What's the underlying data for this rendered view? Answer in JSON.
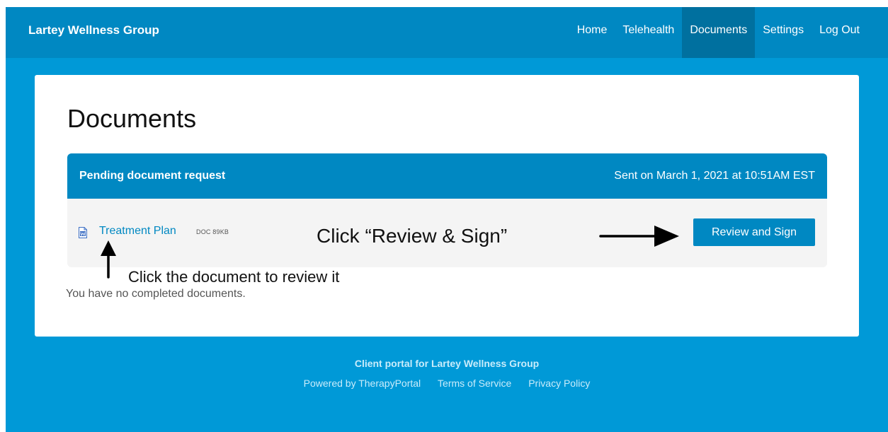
{
  "navbar": {
    "brand": "Lartey Wellness Group",
    "links": [
      {
        "label": "Home"
      },
      {
        "label": "Telehealth"
      },
      {
        "label": "Documents",
        "active": true
      },
      {
        "label": "Settings"
      },
      {
        "label": "Log Out"
      }
    ]
  },
  "main": {
    "title": "Documents",
    "pending_request": {
      "title": "Pending document request",
      "sent": "Sent on March 1, 2021 at 10:51AM EST",
      "document": {
        "icon": "word-document-icon",
        "name": "Treatment Plan",
        "meta": "DOC 89KB"
      },
      "action_label": "Review and Sign"
    },
    "completed_empty": "You have no completed documents."
  },
  "annotations": {
    "sign_instruction": "Click “Review & Sign”",
    "review_instruction": "Click the document to review it"
  },
  "footer": {
    "title": "Client portal for Lartey Wellness Group",
    "links": [
      "Powered by TherapyPortal",
      "Terms of Service",
      "Privacy Policy"
    ]
  },
  "colors": {
    "page_background": "#0099d7",
    "navbar": "#0088c2",
    "nav_active": "#00709f",
    "accent": "#0088c2",
    "request_body": "#f4f4f4"
  }
}
